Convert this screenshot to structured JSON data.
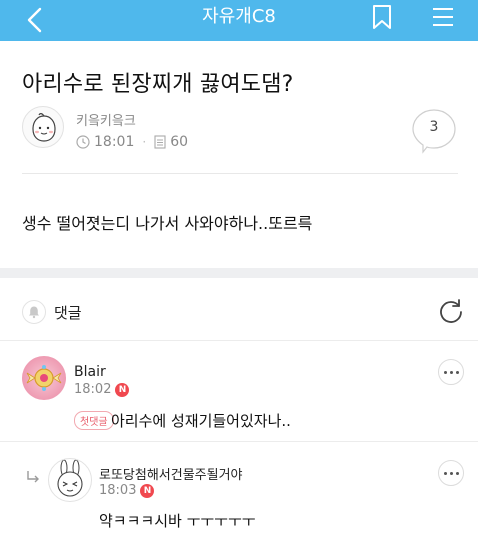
{
  "header": {
    "title": "자유개C8",
    "bg_color": "#4fb8ec",
    "back_icon": "chevron-left-icon",
    "bookmark_icon": "bookmark-icon",
    "menu_icon": "hamburger-menu-icon"
  },
  "post": {
    "title": "아리수로 된장찌개 끓여도댐?",
    "author": "키읔키읔크",
    "time": "18:01",
    "views": "60",
    "comment_count": "3",
    "body": "생수 떨어졋는디 나가서 사와야하나..또르륵"
  },
  "comments_section": {
    "label": "댓글",
    "bell_icon": "bell-icon",
    "refresh_icon": "refresh-icon"
  },
  "comments": [
    {
      "author": "Blair",
      "time": "18:02",
      "new_badge": "N",
      "first_badge": "첫댓글",
      "text": "아리수에 성재기들어있자나.."
    },
    {
      "author": "로또당첨해서건물주될거야",
      "time": "18:03",
      "new_badge": "N",
      "text": "약ㅋㅋㅋ시바 ㅜㅜㅜㅜㅜ",
      "is_reply": true
    }
  ],
  "colors": {
    "accent": "#4fb8ec",
    "new_badge": "#f0484f",
    "first_badge": "#e85c6a"
  }
}
